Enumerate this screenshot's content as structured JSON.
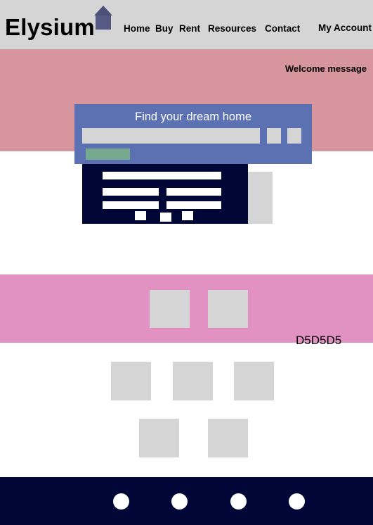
{
  "header": {
    "logo_text": "Elysium",
    "nav": [
      "Home",
      "Buy",
      "Rent",
      "Resources",
      "Contact"
    ],
    "account_label": "My Account"
  },
  "hero": {
    "welcome_text": "Welcome message"
  },
  "search": {
    "title": "Find your dream home"
  },
  "annotation": {
    "color_code": "D5D5D5"
  },
  "colors": {
    "header_bg": "#d5d5d5",
    "hero_bg": "#d7959e",
    "search_card_bg": "#5b71b2",
    "search_submit_bg": "#76a98e",
    "dark_navy": "#000636",
    "pink_band_bg": "#e191c2",
    "placeholder_gray": "#d5d5d5"
  }
}
